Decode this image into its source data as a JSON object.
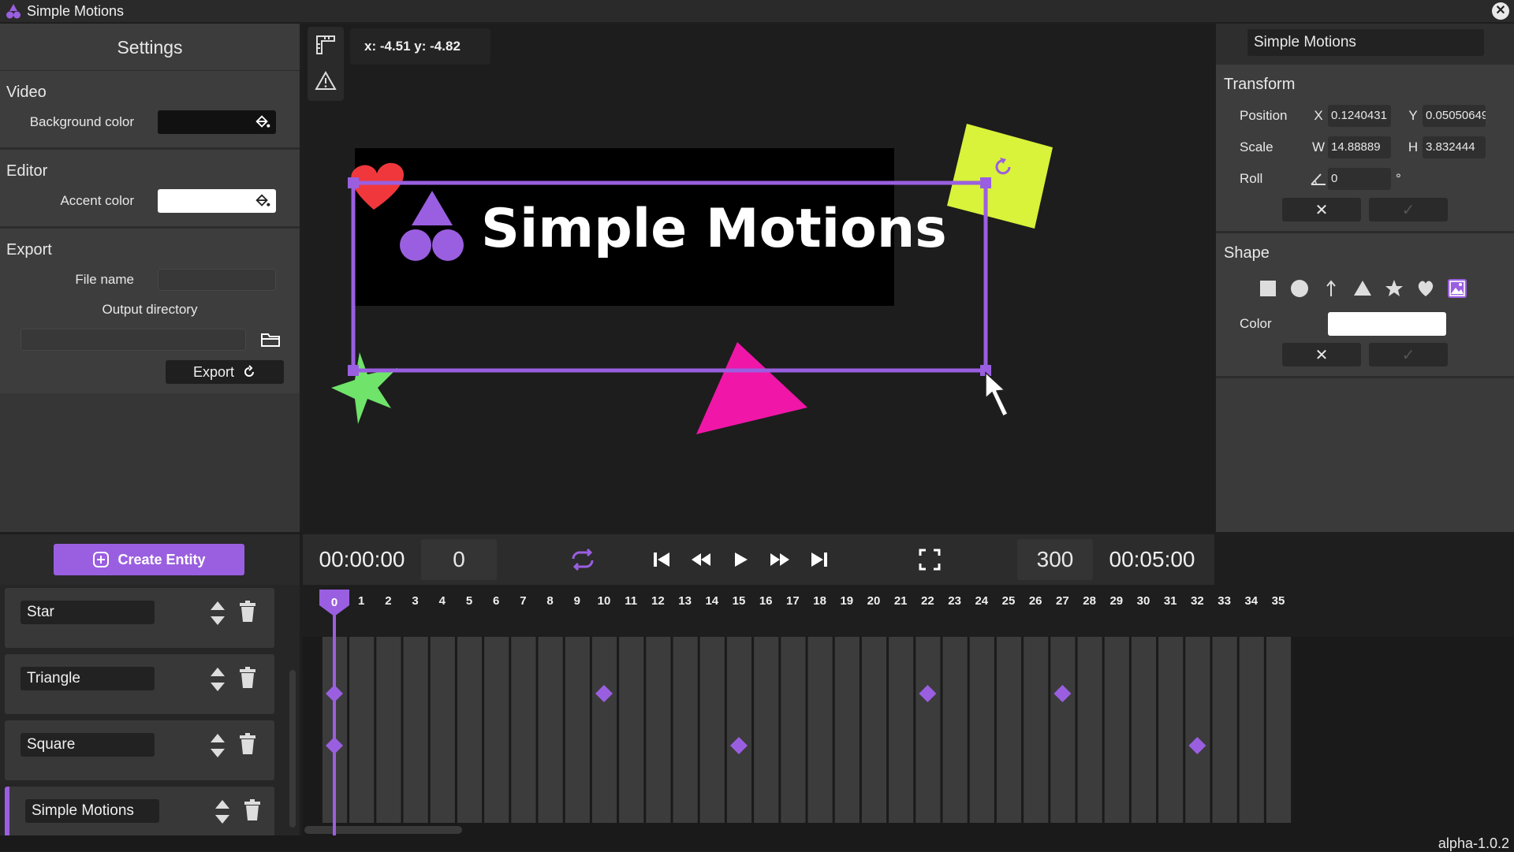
{
  "app": {
    "title": "Simple Motions",
    "version": "alpha-1.0.2"
  },
  "settings": {
    "title": "Settings",
    "video": {
      "title": "Video",
      "background_label": "Background color",
      "background_color": "#111111"
    },
    "editor": {
      "title": "Editor",
      "accent_label": "Accent color",
      "accent_color": "#ffffff"
    },
    "export": {
      "title": "Export",
      "file_name_label": "File name",
      "file_name": "",
      "output_dir_label": "Output directory",
      "output_dir": "",
      "export_label": "Export"
    }
  },
  "preview": {
    "coords": "x: -4.51  y: -4.82",
    "banner_text": "Simple Motions"
  },
  "inspector": {
    "name": "Simple Motions",
    "transform": {
      "title": "Transform",
      "position_label": "Position",
      "x_label": "X",
      "x": "0.1240431",
      "y_label": "Y",
      "y": "0.05050649",
      "scale_label": "Scale",
      "w_label": "W",
      "w": "14.88889",
      "h_label": "H",
      "h": "3.832444",
      "roll_label": "Roll",
      "roll": "0",
      "roll_unit": "°",
      "cancel": "✕",
      "apply": "✓"
    },
    "shape": {
      "title": "Shape",
      "color_label": "Color",
      "color": "#ffffff",
      "cancel": "✕",
      "apply": "✓",
      "icons": [
        "square-icon",
        "circle-icon",
        "arrow-icon",
        "triangle-icon",
        "star-icon",
        "heart-icon",
        "image-icon"
      ]
    }
  },
  "transport": {
    "current_time": "00:00:00",
    "current_frame": "0",
    "end_frame": "300",
    "end_time": "00:05:00"
  },
  "create_entity_label": "Create Entity",
  "entities": [
    {
      "name": "Star",
      "active": false
    },
    {
      "name": "Triangle",
      "active": false
    },
    {
      "name": "Square",
      "active": false
    },
    {
      "name": "Simple Motions",
      "active": true
    }
  ],
  "timeline": {
    "ticks": [
      "0",
      "1",
      "2",
      "3",
      "4",
      "5",
      "6",
      "7",
      "8",
      "9",
      "10",
      "11",
      "12",
      "13",
      "14",
      "15",
      "16",
      "17",
      "18",
      "19",
      "20",
      "21",
      "22",
      "23",
      "24",
      "25",
      "26",
      "27",
      "28",
      "29",
      "30",
      "31",
      "32",
      "33",
      "34",
      "35"
    ],
    "current_frame": 0,
    "tracks": [
      {
        "keyframes": []
      },
      {
        "keyframes": [
          0,
          10,
          22,
          27
        ]
      },
      {
        "keyframes": [
          0,
          15,
          32
        ]
      },
      {
        "keyframes": []
      }
    ]
  },
  "colors": {
    "accent": "#9a5fe0",
    "heart": "#f0383c",
    "yellow": "#d9f23a",
    "star": "#6fe36a",
    "triangle": "#f016a8"
  }
}
